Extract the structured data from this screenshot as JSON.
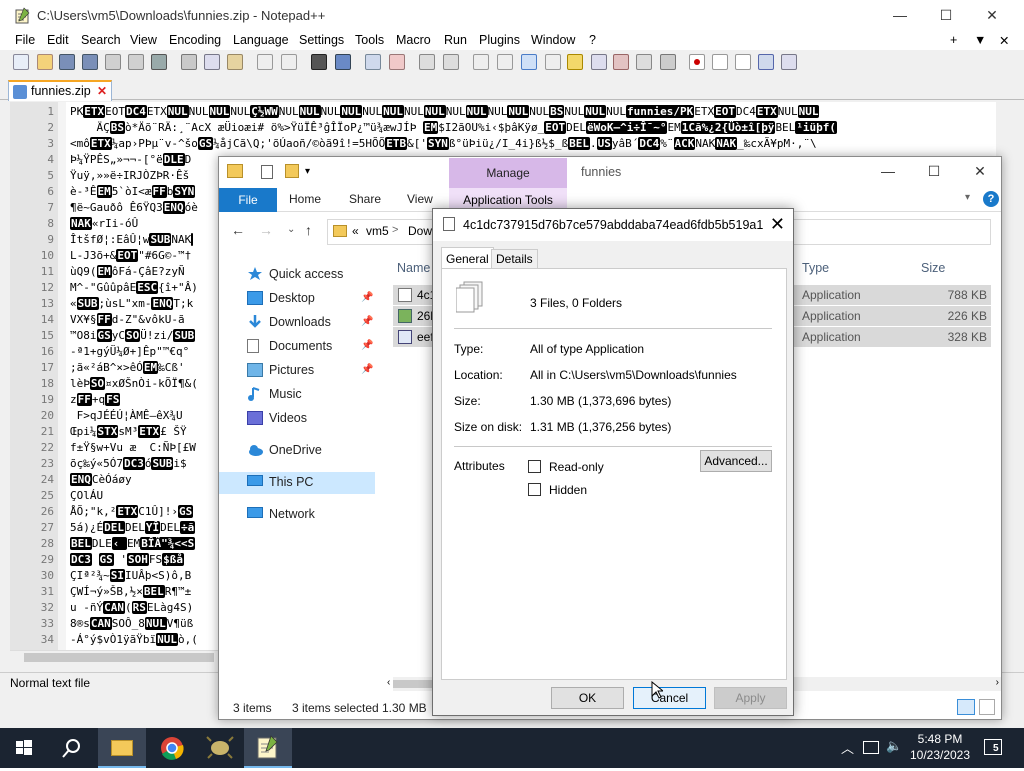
{
  "npp": {
    "title": "C:\\Users\\vm5\\Downloads\\funnies.zip - Notepad++",
    "menu": [
      "File",
      "Edit",
      "Search",
      "View",
      "Encoding",
      "Language",
      "Settings",
      "Tools",
      "Macro",
      "Run",
      "Plugins",
      "Window",
      "?"
    ],
    "menu_right": [
      "+",
      "▼",
      "✕"
    ],
    "tab_name": "funnies.zip",
    "status": "Normal text file",
    "lines": [
      {
        "n": "1",
        "t": "PK|ETX|EOT|DC4|ETX|NUL|NUL|NUL|NUL|Ç½WW|NUL|NUL|NUL|NUL|NUL|NUL|NUL|NUL|NUL|NUL|NUL|NUL|NUL|BS|NUL|NUL|NUL|funnies/PK|ETX|EOT|DC4|ETX|NUL|NUL"
      },
      {
        "n": "2",
        "t": "    ÄÇ|BS|ò*Äõ¨RÄ:¸¨AcX æÜioæi# ö%>ŸüÏÊ³ĝÎÏoP¿™ü¾æwJÍÞ |EM|$I2ãOU%i‹$þâKÿø_|EOT|DEL|ëWoK—^i÷Î¯~°|EM|1Cã%¿2{Üò±î[þÿ|BEL|¹iüþf("
      },
      {
        "n": "3",
        "t": "<mô|ETX|¼ap›PÞµ¨v-^šo|GS|¼åjCã\\Q;'õÚaoñ/©òã9î!=5HÕÕ|ETB|&['|SYN|ß°üÞiü¿/I_4i}ß½$_ß|BEL|.|US|yâB´|DC4|%¨|ACK|NAK|NAK|_‰cxÃ¥pM·,¨\\"
      },
      {
        "n": "4",
        "t": "Þ¼ŸPÊS„»¬¬-[°ë|DLE|D"
      },
      {
        "n": "5",
        "t": "Ÿuÿ,»»ë÷IRJÒZÞR·Êš"
      },
      {
        "n": "6",
        "t": "è-³Ê|EM|5`òI<æ|FF|b|SYN|"
      },
      {
        "n": "7",
        "t": "¶ë~Gauðô Ê6ŸQ3|ENQ|óè"
      },
      {
        "n": "8",
        "t": "|NAK|«rIi-óÛ"
      },
      {
        "n": "9",
        "t": "ÎtšfØ¦:EâÛ¦w|SUB|NAK|"
      },
      {
        "n": "10",
        "t": "L-J3õ+&|EOT|\"#6G©-™†"
      },
      {
        "n": "11",
        "t": "ùQ9(|EM|ôFá-ÇâE?zyÑ"
      },
      {
        "n": "12",
        "t": "M^-\"GûûpâE|ESC|{î+\"Â)"
      },
      {
        "n": "13",
        "t": "«|SUB|;ùsL\"xm-|ENQ|T;k"
      },
      {
        "n": "14",
        "t": "VX¥§|FF|d-Z\"&vôkU-ã"
      },
      {
        "n": "15",
        "t": "™O8i|GS|yC|SO|Ü!zi/|SUB|"
      },
      {
        "n": "16",
        "t": "-ª1+gýÜ¼Ø+]Êp\"™€q°"
      },
      {
        "n": "17",
        "t": ";ã«²áB^×>êÓ|EM|‰Cß'"
      },
      {
        "n": "18",
        "t": "lèÞ|SO|¤xØŠnÒi-kÕÏ¶&("
      },
      {
        "n": "19",
        "t": "z|FF|+q|FS|"
      },
      {
        "n": "20",
        "t": " F>qJÉÉÚ¦ÀMÊ—êX¾U"
      },
      {
        "n": "21",
        "t": "Œpi¼|STX|sM³|ETX|£ ŠŸ"
      },
      {
        "n": "22",
        "t": "f±Ÿ§w+Vu æ  C:ÑÞ[£W"
      },
      {
        "n": "23",
        "t": "õç‰ý«5Ó7|DC3|ó|SUB|i$"
      },
      {
        "n": "24",
        "t": "|ENQ|CèÓáøy"
      },
      {
        "n": "25",
        "t": "ÇOlÁU"
      },
      {
        "n": "26",
        "t": "ÅÕ;\"k,²|ETX|C1Û]!›|GS|"
      },
      {
        "n": "27",
        "t": "5á)¿É|DEL|DEL|YÎ|DEL|÷ã"
      },
      {
        "n": "28",
        "t": "|BEL|DLE|‹ |EM|BÎÄ\"¾<<S"
      },
      {
        "n": "29",
        "t": "|DC3| |GS| '|SOH|FS|$ßå"
      },
      {
        "n": "30",
        "t": "ÇIª²¾~|SI|IUÂþ<S)ô,B"
      },
      {
        "n": "31",
        "t": "ÇWÍ¬ý»ŠB,½×|BEL|R¶™±"
      },
      {
        "n": "32",
        "t": "u -ñÝ|CAN|(|RS|ELàg4S)"
      },
      {
        "n": "33",
        "t": "8®s|CAN|SOÔ_8|NUL|V¶üß"
      },
      {
        "n": "34",
        "t": "-Á°ý$vÒ1ÿãŸbï|NUL|ò,("
      }
    ]
  },
  "explorer": {
    "title": "funnies",
    "manage": "Manage",
    "app_tools": "Application Tools",
    "tabs": {
      "file": "File",
      "home": "Home",
      "share": "Share",
      "view": "View"
    },
    "address": [
      "«",
      "vm5",
      ">",
      "Dow"
    ],
    "nav": [
      {
        "label": "Quick access",
        "icon": "star-icon",
        "pin": false
      },
      {
        "label": "Desktop",
        "icon": "desktop-icon",
        "pin": true
      },
      {
        "label": "Downloads",
        "icon": "downloads-icon",
        "pin": true
      },
      {
        "label": "Documents",
        "icon": "documents-icon",
        "pin": true
      },
      {
        "label": "Pictures",
        "icon": "pictures-icon",
        "pin": true
      },
      {
        "label": "Music",
        "icon": "music-icon",
        "pin": false
      },
      {
        "label": "Videos",
        "icon": "videos-icon",
        "pin": false
      },
      {
        "label": "OneDrive",
        "icon": "cloud-icon",
        "pin": false
      },
      {
        "label": "This PC",
        "icon": "computer-icon",
        "pin": false
      },
      {
        "label": "Network",
        "icon": "network-icon",
        "pin": false
      }
    ],
    "columns": {
      "name": "Name",
      "type": "Type",
      "size": "Size"
    },
    "files": [
      {
        "name": "4c1",
        "type": "Application",
        "size": "788 KB"
      },
      {
        "name": "26b",
        "type": "Application",
        "size": "226 KB"
      },
      {
        "name": "eef",
        "type": "Application",
        "size": "328 KB"
      }
    ],
    "status": {
      "items": "3 items",
      "selected": "3 items selected",
      "size": "1.30 MB"
    }
  },
  "dialog": {
    "title": "4c1dc737915d76b7ce579abddaba74ead6fdb5b519a1ea...",
    "tabs": [
      "General",
      "Details"
    ],
    "summary": "3 Files, 0 Folders",
    "type_label": "Type:",
    "type_value": "All of type Application",
    "location_label": "Location:",
    "location_value": "All in C:\\Users\\vm5\\Downloads\\funnies",
    "size_label": "Size:",
    "size_value": "1.30 MB (1,373,696 bytes)",
    "disk_label": "Size on disk:",
    "disk_value": "1.31 MB (1,376,256 bytes)",
    "attributes_label": "Attributes",
    "readonly": "Read-only",
    "hidden": "Hidden",
    "advanced": "Advanced...",
    "ok": "OK",
    "cancel": "Cancel",
    "apply": "Apply"
  },
  "taskbar": {
    "time": "5:48 PM",
    "date": "10/23/2023",
    "notifications": "5"
  },
  "colors": {
    "accent": "#1979ca",
    "manage": "#d7b8e8",
    "taskbar": "#1b2431",
    "tab_active": "#f6a623"
  }
}
